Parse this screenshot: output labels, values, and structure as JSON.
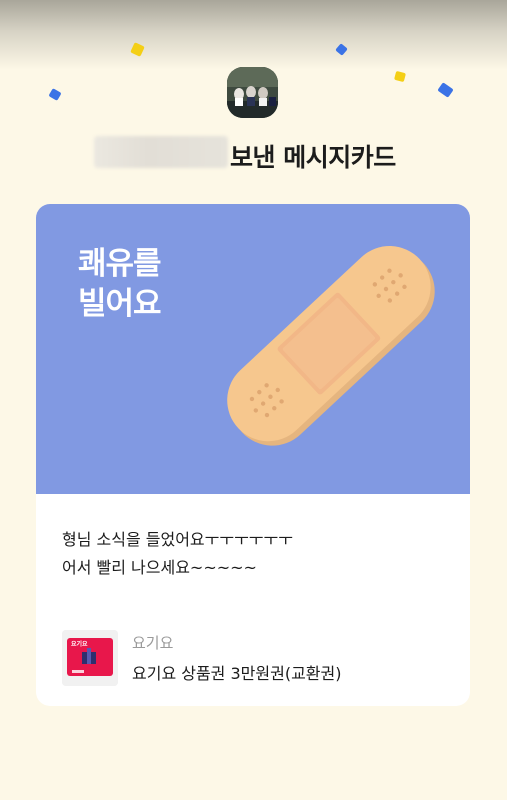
{
  "header": {
    "sender_name_redacted": true,
    "title": "보낸 메시지카드"
  },
  "card": {
    "headline_line1": "쾌유를",
    "headline_line2": "빌어요",
    "illustration": "bandage-illustration",
    "message_lines": [
      "형님 소식을 들었어요ㅜㅜㅜㅜㅜㅜ",
      "어서 빨리 나으세요~~~~~"
    ]
  },
  "gift": {
    "brand": "요기요",
    "name": "요기요 상품권 3만원권(교환권)",
    "thumb_label": "요기요"
  },
  "colors": {
    "background": "#fdf8e7",
    "card_illustration_bg": "#8199e2",
    "bandage": "#f6c78e",
    "confetti_yellow": "#f4cf16",
    "confetti_blue": "#3b73e6",
    "yogiyo_red": "#e8174b"
  }
}
